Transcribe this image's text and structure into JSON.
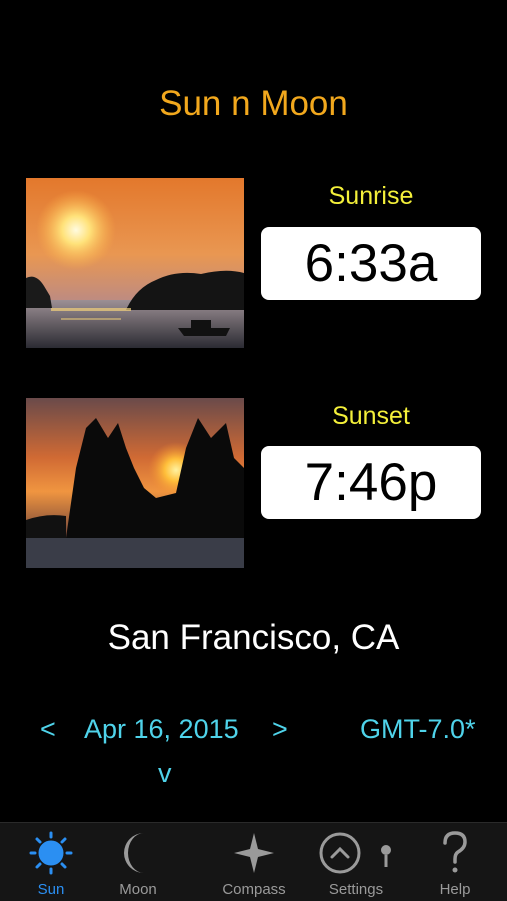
{
  "app": {
    "title": "Sun n Moon"
  },
  "sunrise": {
    "label": "Sunrise",
    "time": "6:33a"
  },
  "sunset": {
    "label": "Sunset",
    "time": "7:46p"
  },
  "location": {
    "city": "San Francisco, CA"
  },
  "date_nav": {
    "prev": "<",
    "date": "Apr 16, 2015",
    "next": ">",
    "timezone": "GMT-7.0*",
    "expand": "v"
  },
  "tabs": [
    {
      "label": "Sun",
      "icon": "sun-icon",
      "active": true
    },
    {
      "label": "Moon",
      "icon": "moon-icon",
      "active": false
    },
    {
      "label": "Compass",
      "icon": "compass-star-icon",
      "active": false
    },
    {
      "label": "Settings",
      "icon": "settings-icon",
      "active": false
    },
    {
      "label": "Help",
      "icon": "help-icon",
      "active": false
    }
  ],
  "colors": {
    "title": "#f2a81d",
    "label": "#f4f03a",
    "nav": "#4fd3ea",
    "tab_active": "#2b8ff2",
    "tab_inactive": "#9a9a9a"
  }
}
